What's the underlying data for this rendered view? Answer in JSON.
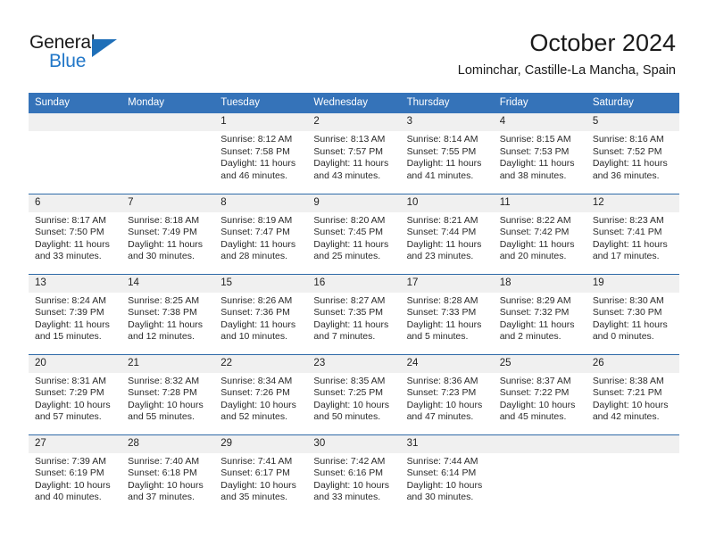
{
  "brand": {
    "word1": "General",
    "word2": "Blue",
    "logo_icon": "triangle-logo-icon",
    "accent_color": "#1f6fb8"
  },
  "header": {
    "title": "October 2024",
    "location": "Lominchar, Castille-La Mancha, Spain"
  },
  "theme": {
    "header_blue": "#3573b9",
    "divider_blue": "#2f6aa8",
    "daynum_bg": "#f0f0f0"
  },
  "calendar": {
    "weekday_headers": [
      "Sunday",
      "Monday",
      "Tuesday",
      "Wednesday",
      "Thursday",
      "Friday",
      "Saturday"
    ],
    "weeks": [
      [
        {
          "day": "",
          "sunrise": "",
          "sunset": "",
          "daylight_1": "",
          "daylight_2": ""
        },
        {
          "day": "",
          "sunrise": "",
          "sunset": "",
          "daylight_1": "",
          "daylight_2": ""
        },
        {
          "day": "1",
          "sunrise": "Sunrise: 8:12 AM",
          "sunset": "Sunset: 7:58 PM",
          "daylight_1": "Daylight: 11 hours",
          "daylight_2": "and 46 minutes."
        },
        {
          "day": "2",
          "sunrise": "Sunrise: 8:13 AM",
          "sunset": "Sunset: 7:57 PM",
          "daylight_1": "Daylight: 11 hours",
          "daylight_2": "and 43 minutes."
        },
        {
          "day": "3",
          "sunrise": "Sunrise: 8:14 AM",
          "sunset": "Sunset: 7:55 PM",
          "daylight_1": "Daylight: 11 hours",
          "daylight_2": "and 41 minutes."
        },
        {
          "day": "4",
          "sunrise": "Sunrise: 8:15 AM",
          "sunset": "Sunset: 7:53 PM",
          "daylight_1": "Daylight: 11 hours",
          "daylight_2": "and 38 minutes."
        },
        {
          "day": "5",
          "sunrise": "Sunrise: 8:16 AM",
          "sunset": "Sunset: 7:52 PM",
          "daylight_1": "Daylight: 11 hours",
          "daylight_2": "and 36 minutes."
        }
      ],
      [
        {
          "day": "6",
          "sunrise": "Sunrise: 8:17 AM",
          "sunset": "Sunset: 7:50 PM",
          "daylight_1": "Daylight: 11 hours",
          "daylight_2": "and 33 minutes."
        },
        {
          "day": "7",
          "sunrise": "Sunrise: 8:18 AM",
          "sunset": "Sunset: 7:49 PM",
          "daylight_1": "Daylight: 11 hours",
          "daylight_2": "and 30 minutes."
        },
        {
          "day": "8",
          "sunrise": "Sunrise: 8:19 AM",
          "sunset": "Sunset: 7:47 PM",
          "daylight_1": "Daylight: 11 hours",
          "daylight_2": "and 28 minutes."
        },
        {
          "day": "9",
          "sunrise": "Sunrise: 8:20 AM",
          "sunset": "Sunset: 7:45 PM",
          "daylight_1": "Daylight: 11 hours",
          "daylight_2": "and 25 minutes."
        },
        {
          "day": "10",
          "sunrise": "Sunrise: 8:21 AM",
          "sunset": "Sunset: 7:44 PM",
          "daylight_1": "Daylight: 11 hours",
          "daylight_2": "and 23 minutes."
        },
        {
          "day": "11",
          "sunrise": "Sunrise: 8:22 AM",
          "sunset": "Sunset: 7:42 PM",
          "daylight_1": "Daylight: 11 hours",
          "daylight_2": "and 20 minutes."
        },
        {
          "day": "12",
          "sunrise": "Sunrise: 8:23 AM",
          "sunset": "Sunset: 7:41 PM",
          "daylight_1": "Daylight: 11 hours",
          "daylight_2": "and 17 minutes."
        }
      ],
      [
        {
          "day": "13",
          "sunrise": "Sunrise: 8:24 AM",
          "sunset": "Sunset: 7:39 PM",
          "daylight_1": "Daylight: 11 hours",
          "daylight_2": "and 15 minutes."
        },
        {
          "day": "14",
          "sunrise": "Sunrise: 8:25 AM",
          "sunset": "Sunset: 7:38 PM",
          "daylight_1": "Daylight: 11 hours",
          "daylight_2": "and 12 minutes."
        },
        {
          "day": "15",
          "sunrise": "Sunrise: 8:26 AM",
          "sunset": "Sunset: 7:36 PM",
          "daylight_1": "Daylight: 11 hours",
          "daylight_2": "and 10 minutes."
        },
        {
          "day": "16",
          "sunrise": "Sunrise: 8:27 AM",
          "sunset": "Sunset: 7:35 PM",
          "daylight_1": "Daylight: 11 hours",
          "daylight_2": "and 7 minutes."
        },
        {
          "day": "17",
          "sunrise": "Sunrise: 8:28 AM",
          "sunset": "Sunset: 7:33 PM",
          "daylight_1": "Daylight: 11 hours",
          "daylight_2": "and 5 minutes."
        },
        {
          "day": "18",
          "sunrise": "Sunrise: 8:29 AM",
          "sunset": "Sunset: 7:32 PM",
          "daylight_1": "Daylight: 11 hours",
          "daylight_2": "and 2 minutes."
        },
        {
          "day": "19",
          "sunrise": "Sunrise: 8:30 AM",
          "sunset": "Sunset: 7:30 PM",
          "daylight_1": "Daylight: 11 hours",
          "daylight_2": "and 0 minutes."
        }
      ],
      [
        {
          "day": "20",
          "sunrise": "Sunrise: 8:31 AM",
          "sunset": "Sunset: 7:29 PM",
          "daylight_1": "Daylight: 10 hours",
          "daylight_2": "and 57 minutes."
        },
        {
          "day": "21",
          "sunrise": "Sunrise: 8:32 AM",
          "sunset": "Sunset: 7:28 PM",
          "daylight_1": "Daylight: 10 hours",
          "daylight_2": "and 55 minutes."
        },
        {
          "day": "22",
          "sunrise": "Sunrise: 8:34 AM",
          "sunset": "Sunset: 7:26 PM",
          "daylight_1": "Daylight: 10 hours",
          "daylight_2": "and 52 minutes."
        },
        {
          "day": "23",
          "sunrise": "Sunrise: 8:35 AM",
          "sunset": "Sunset: 7:25 PM",
          "daylight_1": "Daylight: 10 hours",
          "daylight_2": "and 50 minutes."
        },
        {
          "day": "24",
          "sunrise": "Sunrise: 8:36 AM",
          "sunset": "Sunset: 7:23 PM",
          "daylight_1": "Daylight: 10 hours",
          "daylight_2": "and 47 minutes."
        },
        {
          "day": "25",
          "sunrise": "Sunrise: 8:37 AM",
          "sunset": "Sunset: 7:22 PM",
          "daylight_1": "Daylight: 10 hours",
          "daylight_2": "and 45 minutes."
        },
        {
          "day": "26",
          "sunrise": "Sunrise: 8:38 AM",
          "sunset": "Sunset: 7:21 PM",
          "daylight_1": "Daylight: 10 hours",
          "daylight_2": "and 42 minutes."
        }
      ],
      [
        {
          "day": "27",
          "sunrise": "Sunrise: 7:39 AM",
          "sunset": "Sunset: 6:19 PM",
          "daylight_1": "Daylight: 10 hours",
          "daylight_2": "and 40 minutes."
        },
        {
          "day": "28",
          "sunrise": "Sunrise: 7:40 AM",
          "sunset": "Sunset: 6:18 PM",
          "daylight_1": "Daylight: 10 hours",
          "daylight_2": "and 37 minutes."
        },
        {
          "day": "29",
          "sunrise": "Sunrise: 7:41 AM",
          "sunset": "Sunset: 6:17 PM",
          "daylight_1": "Daylight: 10 hours",
          "daylight_2": "and 35 minutes."
        },
        {
          "day": "30",
          "sunrise": "Sunrise: 7:42 AM",
          "sunset": "Sunset: 6:16 PM",
          "daylight_1": "Daylight: 10 hours",
          "daylight_2": "and 33 minutes."
        },
        {
          "day": "31",
          "sunrise": "Sunrise: 7:44 AM",
          "sunset": "Sunset: 6:14 PM",
          "daylight_1": "Daylight: 10 hours",
          "daylight_2": "and 30 minutes."
        },
        {
          "day": "",
          "sunrise": "",
          "sunset": "",
          "daylight_1": "",
          "daylight_2": ""
        },
        {
          "day": "",
          "sunrise": "",
          "sunset": "",
          "daylight_1": "",
          "daylight_2": ""
        }
      ]
    ]
  }
}
